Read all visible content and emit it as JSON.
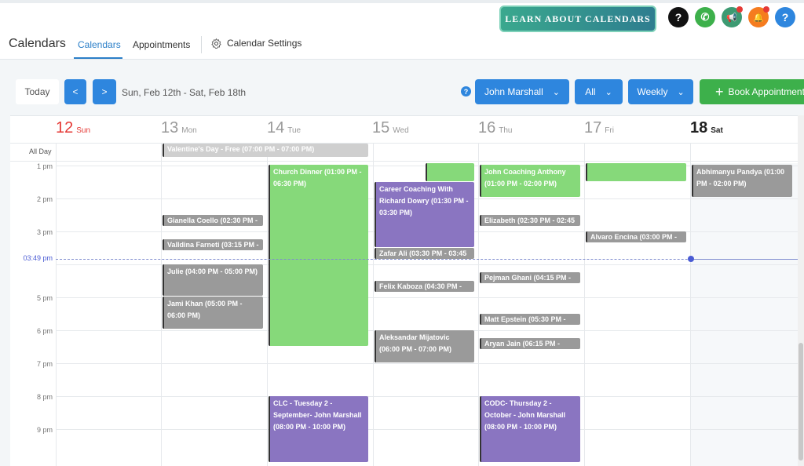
{
  "header": {
    "learn_label": "LEARN ABOUT CALENDARS",
    "icons": [
      {
        "name": "help-circle-icon",
        "glyph": "?",
        "color": "#111111"
      },
      {
        "name": "phone-icon",
        "glyph": "✆",
        "color": "#3db04b"
      },
      {
        "name": "megaphone-icon",
        "glyph": "📢",
        "color": "#3d9a72"
      },
      {
        "name": "bell-icon",
        "glyph": "🔔",
        "color": "#f57c1f"
      },
      {
        "name": "help-icon",
        "glyph": "?",
        "color": "#2e86de"
      }
    ]
  },
  "nav": {
    "title": "Calendars",
    "tabs": [
      "Calendars",
      "Appointments"
    ],
    "settings_label": "Calendar Settings"
  },
  "toolbar": {
    "today": "Today",
    "prev": "<",
    "next": ">",
    "range": "Sun, Feb 12th - Sat, Feb 18th",
    "user": "John Marshall",
    "filter": "All",
    "view": "Weekly",
    "book": "Book Appointment"
  },
  "days": [
    {
      "num": "12",
      "name": "Sun"
    },
    {
      "num": "13",
      "name": "Mon"
    },
    {
      "num": "14",
      "name": "Tue"
    },
    {
      "num": "15",
      "name": "Wed"
    },
    {
      "num": "16",
      "name": "Thu"
    },
    {
      "num": "17",
      "name": "Fri"
    },
    {
      "num": "18",
      "name": "Sat"
    }
  ],
  "allday_label": "All Day",
  "hours": [
    "1 pm",
    "2 pm",
    "3 pm",
    "5 pm",
    "6 pm",
    "7 pm",
    "8 pm",
    "9 pm"
  ],
  "now_label": "03:49 pm",
  "allday_event": "Valentine's Day - Free (07:00 PM - 07:00 PM)",
  "events": {
    "mon1": "Gianella Coello (02:30 PM -",
    "mon2": "Valldina Farneti (03:15 PM -",
    "mon3": "Julie (04:00 PM - 05:00 PM)",
    "mon4": "Jami Khan (05:00 PM - 06:00 PM)",
    "tue1": "Church Dinner (01:00 PM - 06:30 PM)",
    "tue2": "CLC - Tuesday 2 - September- John Marshall (08:00 PM - 10:00 PM)",
    "wed1": "Career Coaching With Richard Dowry (01:30 PM - 03:30 PM)",
    "wed2": "Zafar Ali (03:30 PM - 03:45",
    "wed3": "Felix Kaboza (04:30 PM -",
    "wed4": "Aleksandar Mijatovic (06:00 PM - 07:00 PM)",
    "thu1": "John Coaching Anthony (01:00 PM - 02:00 PM)",
    "thu2": "Elizabeth (02:30 PM - 02:45",
    "thu3": "Pejman Ghani (04:15 PM -",
    "thu4": "Matt Epstein (05:30 PM -",
    "thu5": "Aryan Jain (06:15 PM -",
    "thu6": "CODC- Thursday 2 - October - John Marshall (08:00 PM - 10:00 PM)",
    "fri1": "Alvaro Encina (03:00 PM -",
    "sat1": "Abhimanyu Pandya (01:00 PM - 02:00 PM)"
  }
}
